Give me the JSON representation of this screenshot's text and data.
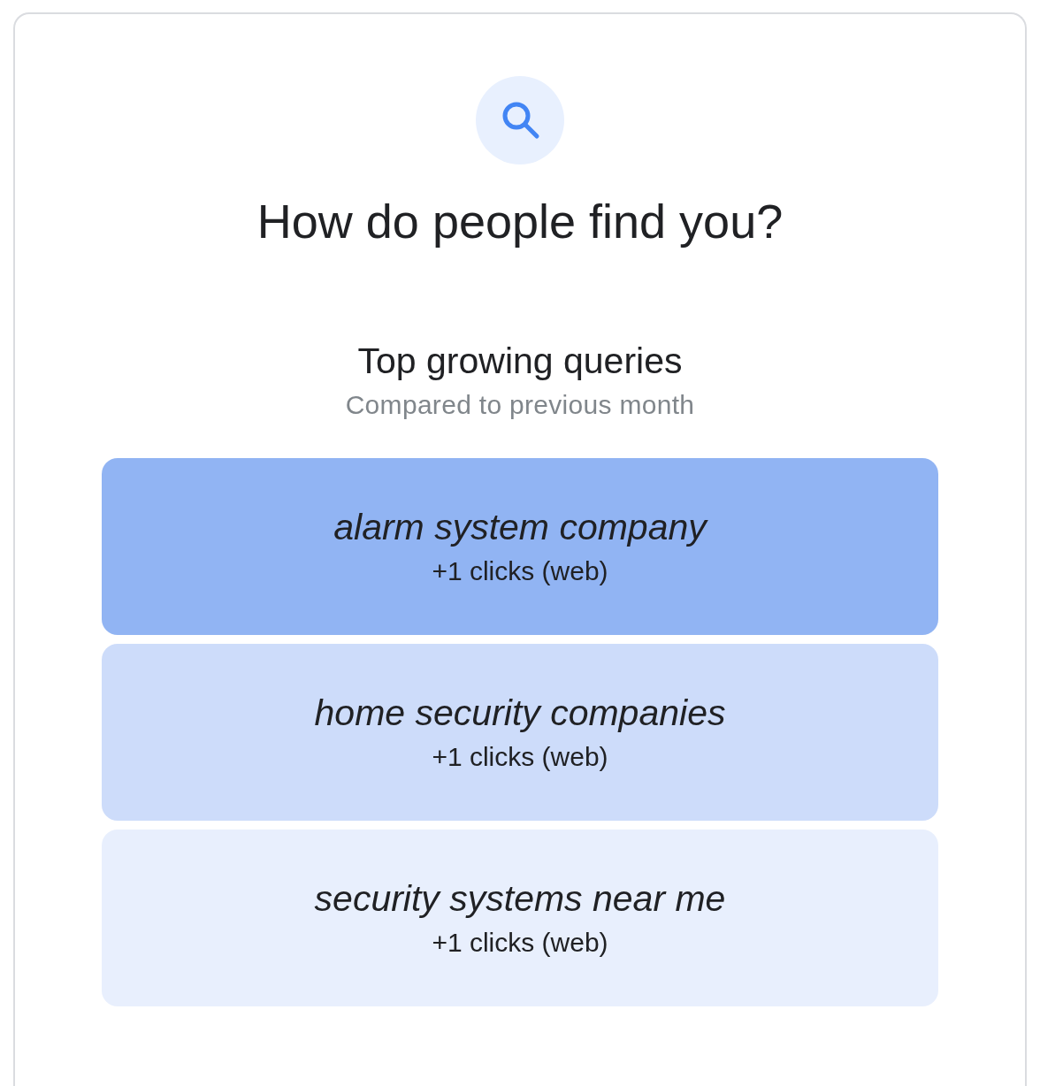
{
  "heading": "How do people find you?",
  "section": {
    "title": "Top growing queries",
    "subtitle": "Compared to previous month"
  },
  "queries": [
    {
      "query": "alarm system company",
      "clicks": "+1 clicks (web)",
      "color": "#91b4f3"
    },
    {
      "query": "home security companies",
      "clicks": "+1 clicks (web)",
      "color": "#cddcfa"
    },
    {
      "query": "security systems near me",
      "clicks": "+1 clicks (web)",
      "color": "#e8effd"
    }
  ]
}
